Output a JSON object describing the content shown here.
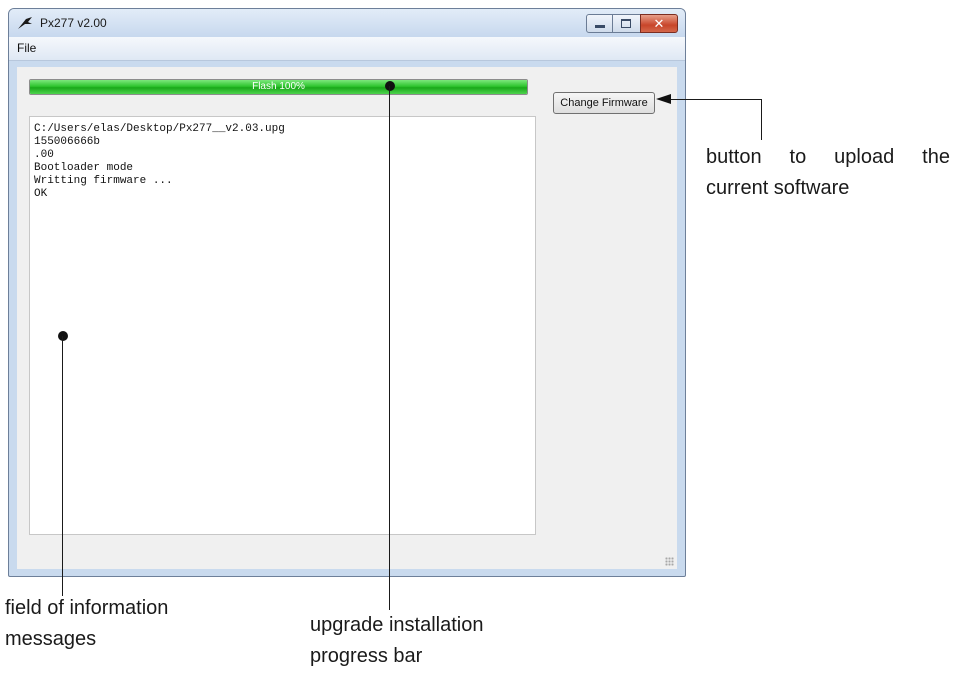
{
  "window": {
    "title": "Px277 v2.00",
    "menu": [
      "File"
    ],
    "caption_buttons": {
      "minimize": "minimize-icon",
      "maximize": "maximize-icon",
      "close": "close-icon"
    }
  },
  "progress": {
    "label": "Flash 100%",
    "value": 1.0
  },
  "log_lines": [
    "C:/Users/elas/Desktop/Px277__v2.03.upg",
    "155006666b",
    ".00",
    "Bootloader mode",
    "Writting firmware ...",
    "OK"
  ],
  "change_firmware_label": "Change Firmware",
  "annotations": {
    "button_line1": "button to upload the",
    "button_line2": "current software",
    "field_line1": "field of information",
    "field_line2": "messages",
    "progress_line1": "upgrade installation",
    "progress_line2": "progress bar"
  },
  "colors": {
    "progress_fill": "#2fc52f",
    "close_button": "#c8452a"
  }
}
